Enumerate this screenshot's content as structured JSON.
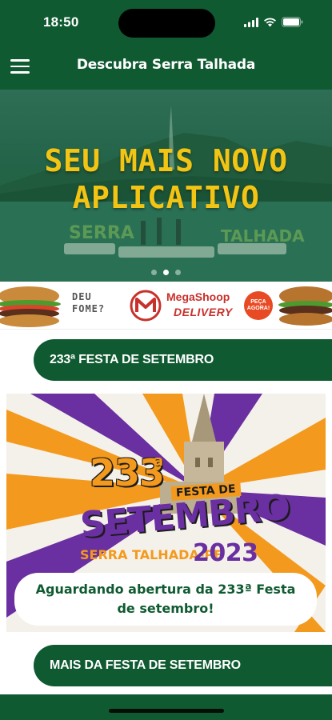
{
  "status_bar": {
    "time": "18:50"
  },
  "header": {
    "title": "Descubra Serra Talhada",
    "menu_icon": "hamburger-icon"
  },
  "hero": {
    "line1": "SEU MAIS NOVO",
    "line2": "APLICATIVO",
    "sign_left": "SERRA",
    "sign_right": "TALHADA",
    "slide_count": 3,
    "active_slide": 2
  },
  "ad": {
    "tagline_line1": "DEU",
    "tagline_line2": "FOME?",
    "brand": "MegaShoop",
    "service": "DELIVERY",
    "cta_line1": "PEÇA",
    "cta_line2": "AGORA!"
  },
  "sections": [
    {
      "label": "233ª FESTA DE SETEMBRO"
    },
    {
      "label": "MAIS DA FESTA DE SETEMBRO"
    }
  ],
  "poster": {
    "number": "233",
    "number_suffix": "a",
    "festa_de": "FESTA DE",
    "setembro": "SETEMBRO",
    "location": "SERRA TALHADA-PE",
    "year": "2023",
    "message": "Aguardando abertura da 233ª Festa de setembro!"
  },
  "colors": {
    "primary_green": "#0f5a31",
    "hero_yellow": "#f2c414",
    "poster_orange": "#f39a1e",
    "poster_purple": "#6a2fa0"
  }
}
